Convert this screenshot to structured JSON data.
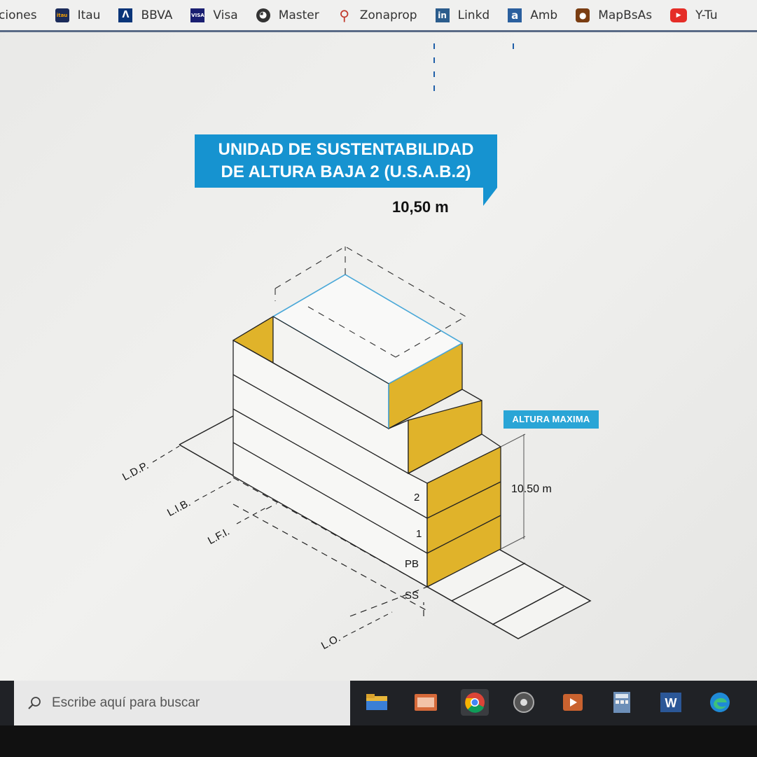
{
  "bookmarks": [
    {
      "label": "ciones",
      "icon": "none"
    },
    {
      "label": "Itau",
      "icon": "itau-icon",
      "icon_text": "itau"
    },
    {
      "label": "BBVA",
      "icon": "bbva-icon",
      "icon_text": "Λ"
    },
    {
      "label": "Visa",
      "icon": "visa-icon",
      "icon_text": "VISA"
    },
    {
      "label": "Master",
      "icon": "globe-icon",
      "icon_text": "◕"
    },
    {
      "label": "Zonaprop",
      "icon": "key-icon",
      "icon_text": "⚲"
    },
    {
      "label": "Linkd",
      "icon": "linkedin-icon",
      "icon_text": "in"
    },
    {
      "label": "Amb",
      "icon": "amb-icon",
      "icon_text": "a"
    },
    {
      "label": "MapBsAs",
      "icon": "map-pin-icon",
      "icon_text": "●"
    },
    {
      "label": "Y-Tu",
      "icon": "youtube-icon",
      "icon_text": "▶"
    }
  ],
  "diagram": {
    "title_line1": "UNIDAD DE SUSTENTABILIDAD",
    "title_line2": "DE ALTURA BAJA 2 (U.S.A.B.2)",
    "height": "10,50 m",
    "badge": "ALTURA MAXIMA",
    "dimension": "10.50 m",
    "floors": [
      "2",
      "1",
      "PB",
      "SS"
    ],
    "lines": [
      "L.D.P.",
      "L.I.B.",
      "L.F.I.",
      "L.O."
    ],
    "colors": {
      "accent": "#1693d0",
      "facade": "#e0b32a",
      "badge": "#2aa5d6"
    }
  },
  "taskbar": {
    "search_placeholder": "Escribe aquí para buscar",
    "apps": [
      "file-explorer-icon",
      "mail-icon",
      "chrome-icon",
      "media-player-icon",
      "video-editor-icon",
      "calculator-icon",
      "word-icon",
      "edge-icon"
    ]
  }
}
